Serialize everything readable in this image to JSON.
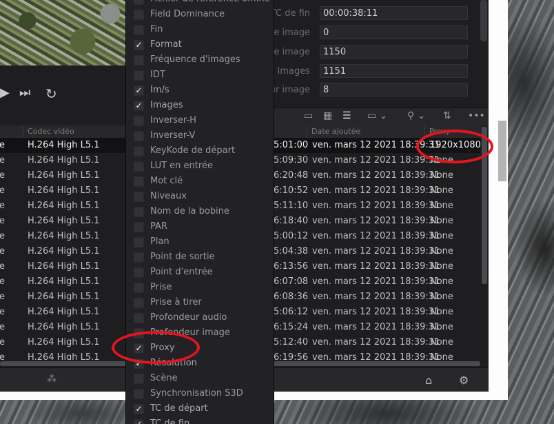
{
  "transport": {
    "next_icon": "⏭",
    "loop_icon": "↻",
    "play_icon": "▶"
  },
  "info_fields": [
    {
      "label": "TC de fin",
      "value": "00:00:38:11"
    },
    {
      "label": "ière image",
      "value": "0"
    },
    {
      "label": "ière image",
      "value": "1150"
    },
    {
      "label": "Images",
      "value": "1151"
    },
    {
      "label": "leur image",
      "value": "8"
    }
  ],
  "toolbar_icons": [
    "metadata-view-icon",
    "thumbnail-view-icon",
    "list-view-icon",
    "timeline-view-icon",
    "search-icon",
    "sort-icon",
    "more-icon"
  ],
  "columns": {
    "codec": "Codec vidéo",
    "date": "Date ajoutée",
    "proxy": "Proxy"
  },
  "rows": [
    {
      "codec": "H.264 High L5.1",
      "tc": "5:01:00",
      "date": "ven. mars 12 2021 18:39:31",
      "proxy": "1920x1080"
    },
    {
      "codec": "H.264 High L5.1",
      "tc": "5:09:30",
      "date": "ven. mars 12 2021 18:39:31",
      "proxy": "None"
    },
    {
      "codec": "H.264 High L5.1",
      "tc": "6:20:48",
      "date": "ven. mars 12 2021 18:39:31",
      "proxy": "None"
    },
    {
      "codec": "H.264 High L5.1",
      "tc": "6:10:52",
      "date": "ven. mars 12 2021 18:39:31",
      "proxy": "None"
    },
    {
      "codec": "H.264 High L5.1",
      "tc": "5:11:10",
      "date": "ven. mars 12 2021 18:39:31",
      "proxy": "None"
    },
    {
      "codec": "H.264 High L5.1",
      "tc": "6:18:40",
      "date": "ven. mars 12 2021 18:39:31",
      "proxy": "None"
    },
    {
      "codec": "H.264 High L5.1",
      "tc": "5:00:12",
      "date": "ven. mars 12 2021 18:39:31",
      "proxy": "None"
    },
    {
      "codec": "H.264 High L5.1",
      "tc": "5:04:38",
      "date": "ven. mars 12 2021 18:39:31",
      "proxy": "None"
    },
    {
      "codec": "H.264 High L5.1",
      "tc": "6:13:56",
      "date": "ven. mars 12 2021 18:39:31",
      "proxy": "None"
    },
    {
      "codec": "H.264 High L5.1",
      "tc": "6:07:08",
      "date": "ven. mars 12 2021 18:39:31",
      "proxy": "None"
    },
    {
      "codec": "H.264 High L5.1",
      "tc": "6:08:36",
      "date": "ven. mars 12 2021 18:39:31",
      "proxy": "None"
    },
    {
      "codec": "H.264 High L5.1",
      "tc": "5:06:12",
      "date": "ven. mars 12 2021 18:39:31",
      "proxy": "None"
    },
    {
      "codec": "H.264 High L5.1",
      "tc": "6:15:24",
      "date": "ven. mars 12 2021 18:39:31",
      "proxy": "None"
    },
    {
      "codec": "H.264 High L5.1",
      "tc": "5:12:40",
      "date": "ven. mars 12 2021 18:39:31",
      "proxy": "None"
    },
    {
      "codec": "H.264 High L5.1",
      "tc": "6:19:56",
      "date": "ven. mars 12 2021 18:39:31",
      "proxy": "None"
    }
  ],
  "row_prefix": "e",
  "footer": {
    "spinner_icon": "⁂",
    "home_icon": "⌂",
    "settings_icon": "⚙"
  },
  "menu_items": [
    {
      "label": "Fichier de référence offline",
      "checked": false
    },
    {
      "label": "Field Dominance",
      "checked": false
    },
    {
      "label": "Fin",
      "checked": false
    },
    {
      "label": "Format",
      "checked": true
    },
    {
      "label": "Fréquence d'images",
      "checked": false
    },
    {
      "label": "IDT",
      "checked": false
    },
    {
      "label": "Im/s",
      "checked": true
    },
    {
      "label": "Images",
      "checked": true
    },
    {
      "label": "Inverser-H",
      "checked": false
    },
    {
      "label": "Inverser-V",
      "checked": false
    },
    {
      "label": "KeyKode de départ",
      "checked": false
    },
    {
      "label": "LUT en entrée",
      "checked": false
    },
    {
      "label": "Mot clé",
      "checked": false
    },
    {
      "label": "Niveaux",
      "checked": false
    },
    {
      "label": "Nom de la bobine",
      "checked": false
    },
    {
      "label": "PAR",
      "checked": false
    },
    {
      "label": "Plan",
      "checked": false
    },
    {
      "label": "Point de sortie",
      "checked": false
    },
    {
      "label": "Point d'entrée",
      "checked": false
    },
    {
      "label": "Prise",
      "checked": false
    },
    {
      "label": "Prise à tirer",
      "checked": false
    },
    {
      "label": "Profondeur audio",
      "checked": false
    },
    {
      "label": "Profondeur image",
      "checked": false
    },
    {
      "label": "Proxy",
      "checked": true
    },
    {
      "label": "Résolution",
      "checked": true
    },
    {
      "label": "Scène",
      "checked": false
    },
    {
      "label": "Synchronisation S3D",
      "checked": false
    },
    {
      "label": "TC de départ",
      "checked": true
    },
    {
      "label": "TC de fin",
      "checked": true
    }
  ],
  "annotation_color": "#e4151c"
}
